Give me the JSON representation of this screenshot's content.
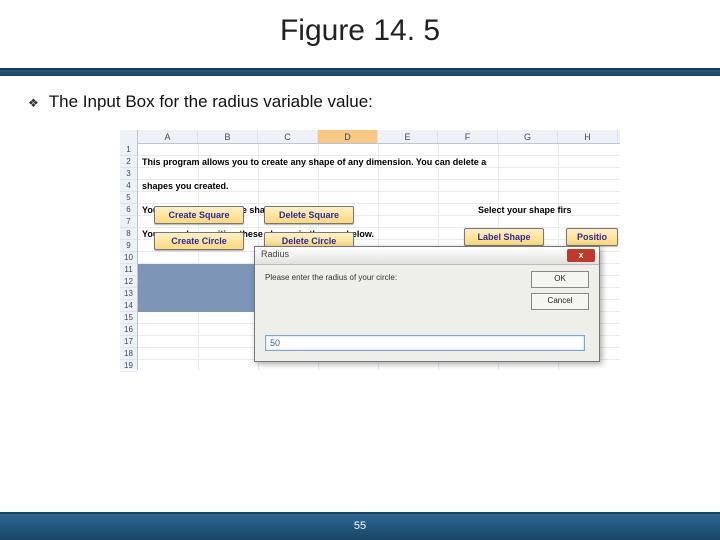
{
  "slide": {
    "title": "Figure 14. 5",
    "bullet": "The Input Box for the radius variable value:",
    "page": "55"
  },
  "excel": {
    "columns": [
      "A",
      "B",
      "C",
      "D",
      "E",
      "F",
      "G",
      "H"
    ],
    "active_column": "D",
    "rows": [
      "1",
      "2",
      "3",
      "4",
      "5",
      "6",
      "7",
      "8",
      "9",
      "10",
      "11",
      "12",
      "13",
      "14",
      "15",
      "16",
      "17",
      "18",
      "19"
    ],
    "text_lines": [
      "This program allows you to create any shape of any dimension. You can delete a",
      "shapes you created.",
      "You can then label these shapes.",
      "You may also position these shapes in the area below."
    ],
    "buttons": {
      "create_square": "Create Square",
      "delete_square": "Delete Square",
      "create_circle": "Create Circle",
      "delete_circle": "Delete Circle",
      "label_shape": "Label Shape",
      "position": "Positio",
      "select_label": "Select your shape firs"
    }
  },
  "dialog": {
    "title": "Radius",
    "prompt": "Please enter the radius of your circle:",
    "ok": "OK",
    "cancel": "Cancel",
    "input_value": "50",
    "close_glyph": "x"
  }
}
